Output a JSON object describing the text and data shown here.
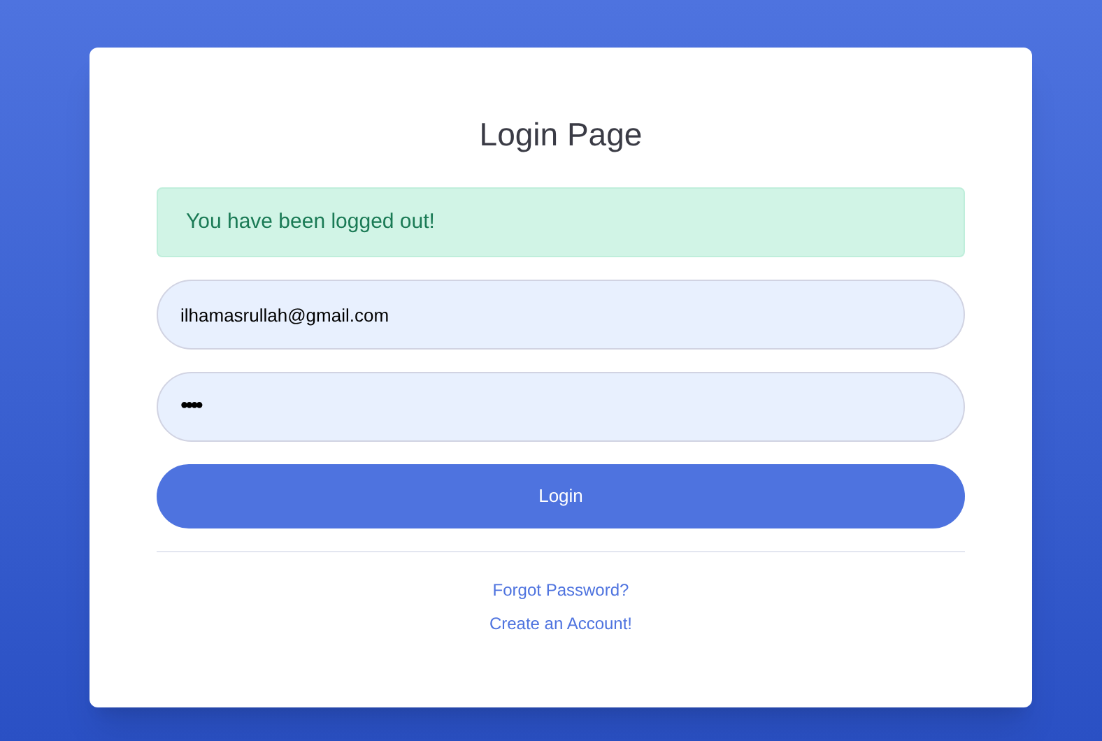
{
  "title": "Login Page",
  "alert": {
    "text": "You have been logged out!"
  },
  "fields": [
    {
      "kind": "email",
      "value": "ilhamasrullah@gmail.com"
    },
    {
      "kind": "password",
      "value": "••••"
    }
  ],
  "button": {
    "label": "Login"
  },
  "links": [
    "Forgot Password?",
    "Create an Account!"
  ]
}
